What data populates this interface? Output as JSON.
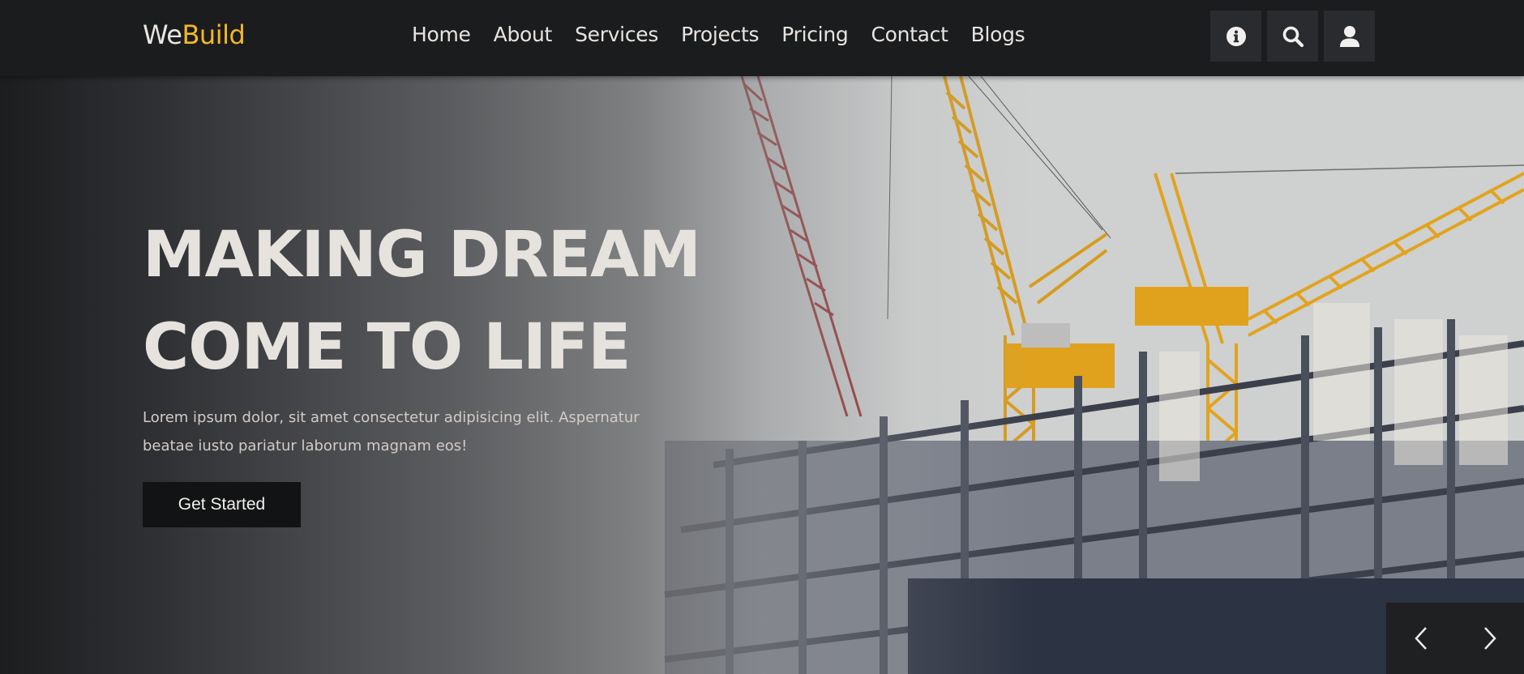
{
  "header": {
    "logo": {
      "part1": "We",
      "part2": "Build",
      "accent": "#f4b825"
    },
    "nav": [
      {
        "label": "Home"
      },
      {
        "label": "About"
      },
      {
        "label": "Services"
      },
      {
        "label": "Projects"
      },
      {
        "label": "Pricing"
      },
      {
        "label": "Contact"
      },
      {
        "label": "Blogs"
      }
    ],
    "icons": [
      "info-icon",
      "search-icon",
      "user-icon"
    ]
  },
  "hero": {
    "title_line1": "MAKING DREAM",
    "title_line2": "COME TO LIFE",
    "description": "Lorem ipsum dolor, sit amet consectetur adipisicing elit. Aspernatur beatae iusto pariatur laborum magnam eos!",
    "cta_label": "Get Started",
    "controls": [
      "chevron-left-icon",
      "chevron-right-icon"
    ]
  }
}
